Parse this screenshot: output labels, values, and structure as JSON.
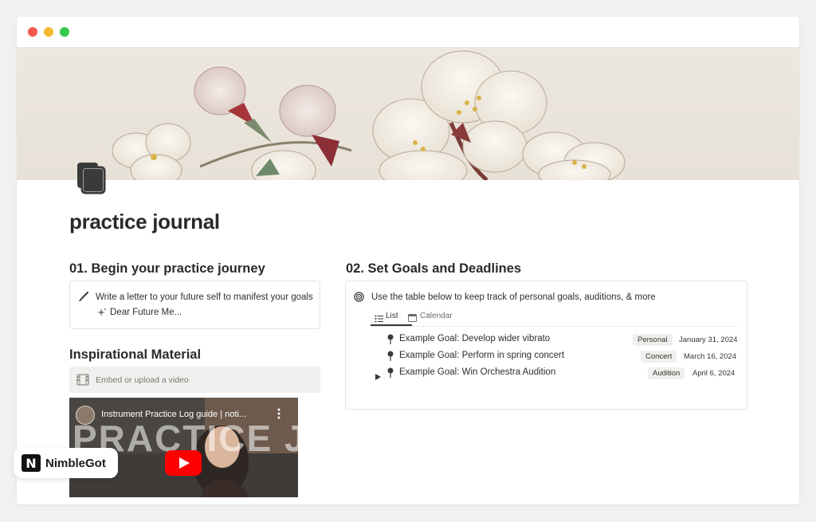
{
  "page": {
    "title": "practice journal",
    "icon": "book-stack-icon"
  },
  "section1": {
    "heading": "01. Begin your practice journey",
    "callout_text": "Write a letter to your future self to manifest your goals",
    "link_label": "Dear Future Me...",
    "callout_icon": "paintbrush-icon",
    "link_icon": "sparkle-icon"
  },
  "inspiration": {
    "heading": "Inspirational Material",
    "embed_placeholder": "Embed or upload a video",
    "video": {
      "title": "Instrument Practice Log guide | noti...",
      "overlay_text": "PRACTICE JOURNAL"
    }
  },
  "section2": {
    "heading": "02. Set Goals and Deadlines",
    "callout_text": "Use the table below to keep track of personal goals, auditions, & more",
    "callout_icon": "target-icon",
    "tabs": [
      {
        "label": "List",
        "icon": "list-icon",
        "active": true
      },
      {
        "label": "Calendar",
        "icon": "calendar-icon",
        "active": false
      }
    ],
    "goals": [
      {
        "title": "Example Goal: Develop wider vibrato",
        "tag": "Personal",
        "date": "January 31, 2024",
        "expandable": false
      },
      {
        "title": "Example Goal: Perform in spring concert",
        "tag": "Concert",
        "date": "March 16, 2024",
        "expandable": false
      },
      {
        "title": "Example Goal: Win Orchestra Audition",
        "tag": "Audition",
        "date": "April 6, 2024",
        "expandable": true
      }
    ]
  },
  "badge": {
    "brand": "NimbleGot",
    "logo_letter": "N"
  },
  "colors": {
    "window_red": "#f05a4f",
    "window_yellow": "#f5b82e",
    "window_green": "#35c94a",
    "youtube_red": "#ff0000"
  }
}
